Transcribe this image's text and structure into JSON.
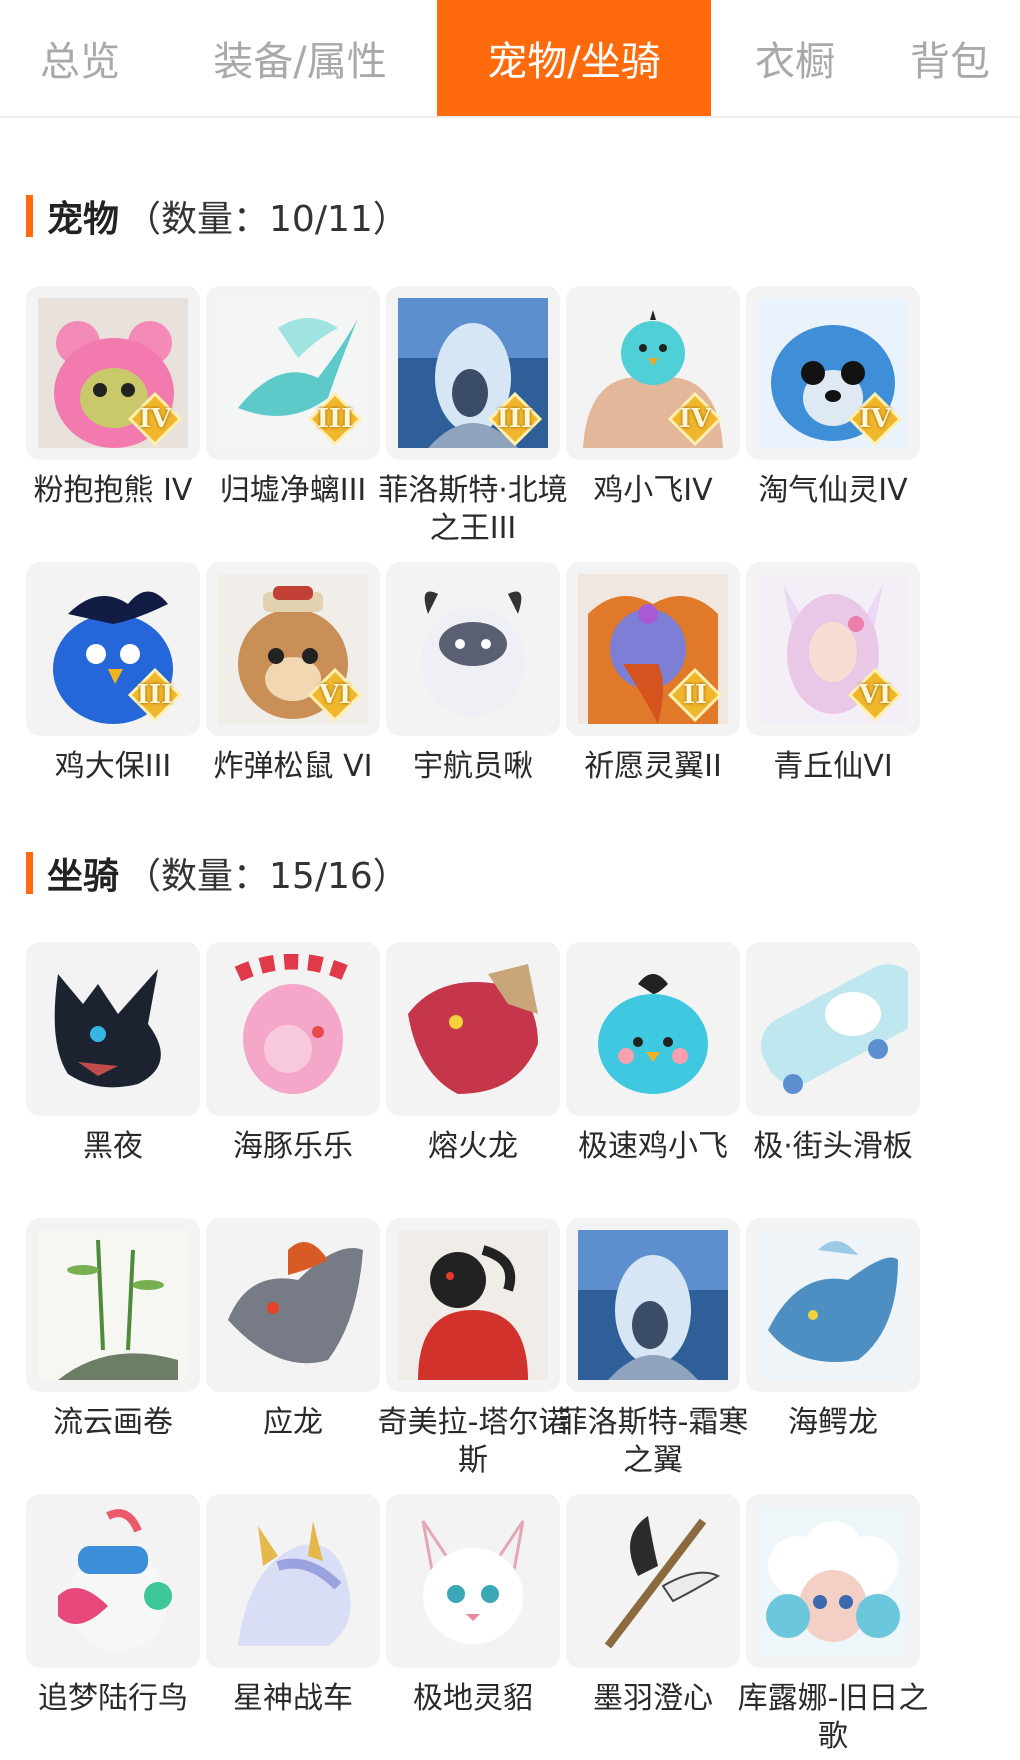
{
  "tabs": [
    {
      "label": "总览",
      "active": false
    },
    {
      "label": "装备/属性",
      "active": false
    },
    {
      "label": "宠物/坐骑",
      "active": true
    },
    {
      "label": "衣橱",
      "active": false
    },
    {
      "label": "背包",
      "active": false
    }
  ],
  "accent_color": "#ff6a0c",
  "pets": {
    "title": "宠物",
    "count_text": "（数量：10/11）",
    "items": [
      {
        "name": "粉抱抱熊 IV",
        "tier": "IV",
        "icon": "pink-bear-icon"
      },
      {
        "name": "归墟净螭III",
        "tier": "III",
        "icon": "cyan-dragon-icon"
      },
      {
        "name": "菲洛斯特·北境之王III",
        "tier": "III",
        "icon": "ice-knight-icon"
      },
      {
        "name": "鸡小飞IV",
        "tier": "IV",
        "icon": "chick-muscle-icon"
      },
      {
        "name": "淘气仙灵IV",
        "tier": "IV",
        "icon": "blue-puppy-icon"
      },
      {
        "name": "鸡大保III",
        "tier": "III",
        "icon": "blue-bird-icon"
      },
      {
        "name": "炸弹松鼠 VI",
        "tier": "VI",
        "icon": "squirrel-icon"
      },
      {
        "name": "宇航员啾",
        "tier": "",
        "icon": "astronaut-cow-icon"
      },
      {
        "name": "祈愿灵翼II",
        "tier": "II",
        "icon": "phoenix-eagle-icon"
      },
      {
        "name": "青丘仙VI",
        "tier": "VI",
        "icon": "fox-fairy-icon"
      }
    ]
  },
  "mounts": {
    "title": "坐骑",
    "count_text": "（数量：15/16）",
    "items": [
      {
        "name": "黑夜",
        "icon": "black-dragon-icon"
      },
      {
        "name": "海豚乐乐",
        "icon": "pink-dolphin-icon"
      },
      {
        "name": "熔火龙",
        "icon": "red-dragon-icon"
      },
      {
        "name": "极速鸡小飞",
        "icon": "blue-chick-icon"
      },
      {
        "name": "极·街头滑板",
        "icon": "skateboard-icon"
      },
      {
        "name": "流云画卷",
        "icon": "bamboo-scroll-icon"
      },
      {
        "name": "应龙",
        "icon": "gray-dragon-icon"
      },
      {
        "name": "奇美拉-塔尔诺斯",
        "icon": "chimera-icon"
      },
      {
        "name": "菲洛斯特-霜寒之翼",
        "icon": "ice-knight-icon"
      },
      {
        "name": "海鳄龙",
        "icon": "sea-dragon-icon"
      },
      {
        "name": "追梦陆行鸟",
        "icon": "headphone-bird-icon"
      },
      {
        "name": "星神战车",
        "icon": "star-horse-icon"
      },
      {
        "name": "极地灵貂",
        "icon": "white-fox-icon"
      },
      {
        "name": "墨羽澄心",
        "icon": "feather-sword-icon"
      },
      {
        "name": "库露娜-旧日之歌",
        "icon": "cloud-sheep-icon"
      }
    ]
  }
}
